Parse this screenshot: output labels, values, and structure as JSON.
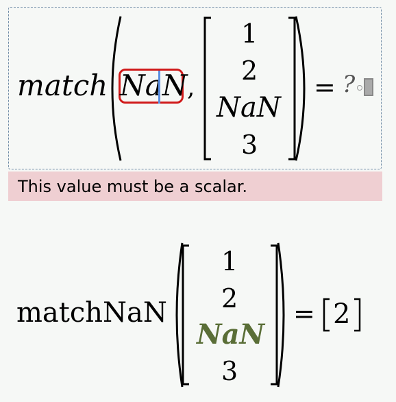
{
  "editor": {
    "function_name": "match",
    "argument": "NaN",
    "comma": ",",
    "vector": [
      "1",
      "2",
      "NaN",
      "3"
    ],
    "equals": "=",
    "result_placeholder": "?"
  },
  "error": {
    "message": "This value must be a scalar."
  },
  "output": {
    "function_name": "matchNaN",
    "vector": [
      "1",
      "2",
      "NaN",
      "3"
    ],
    "highlight_index": 2,
    "highlight_color": "#5a6e37",
    "equals": "=",
    "result": "2"
  },
  "colors": {
    "error_border": "#d01a1a",
    "error_background": "#efcfd2",
    "caret": "#5a8ee0",
    "dashed_border": "#6f8ba6"
  }
}
